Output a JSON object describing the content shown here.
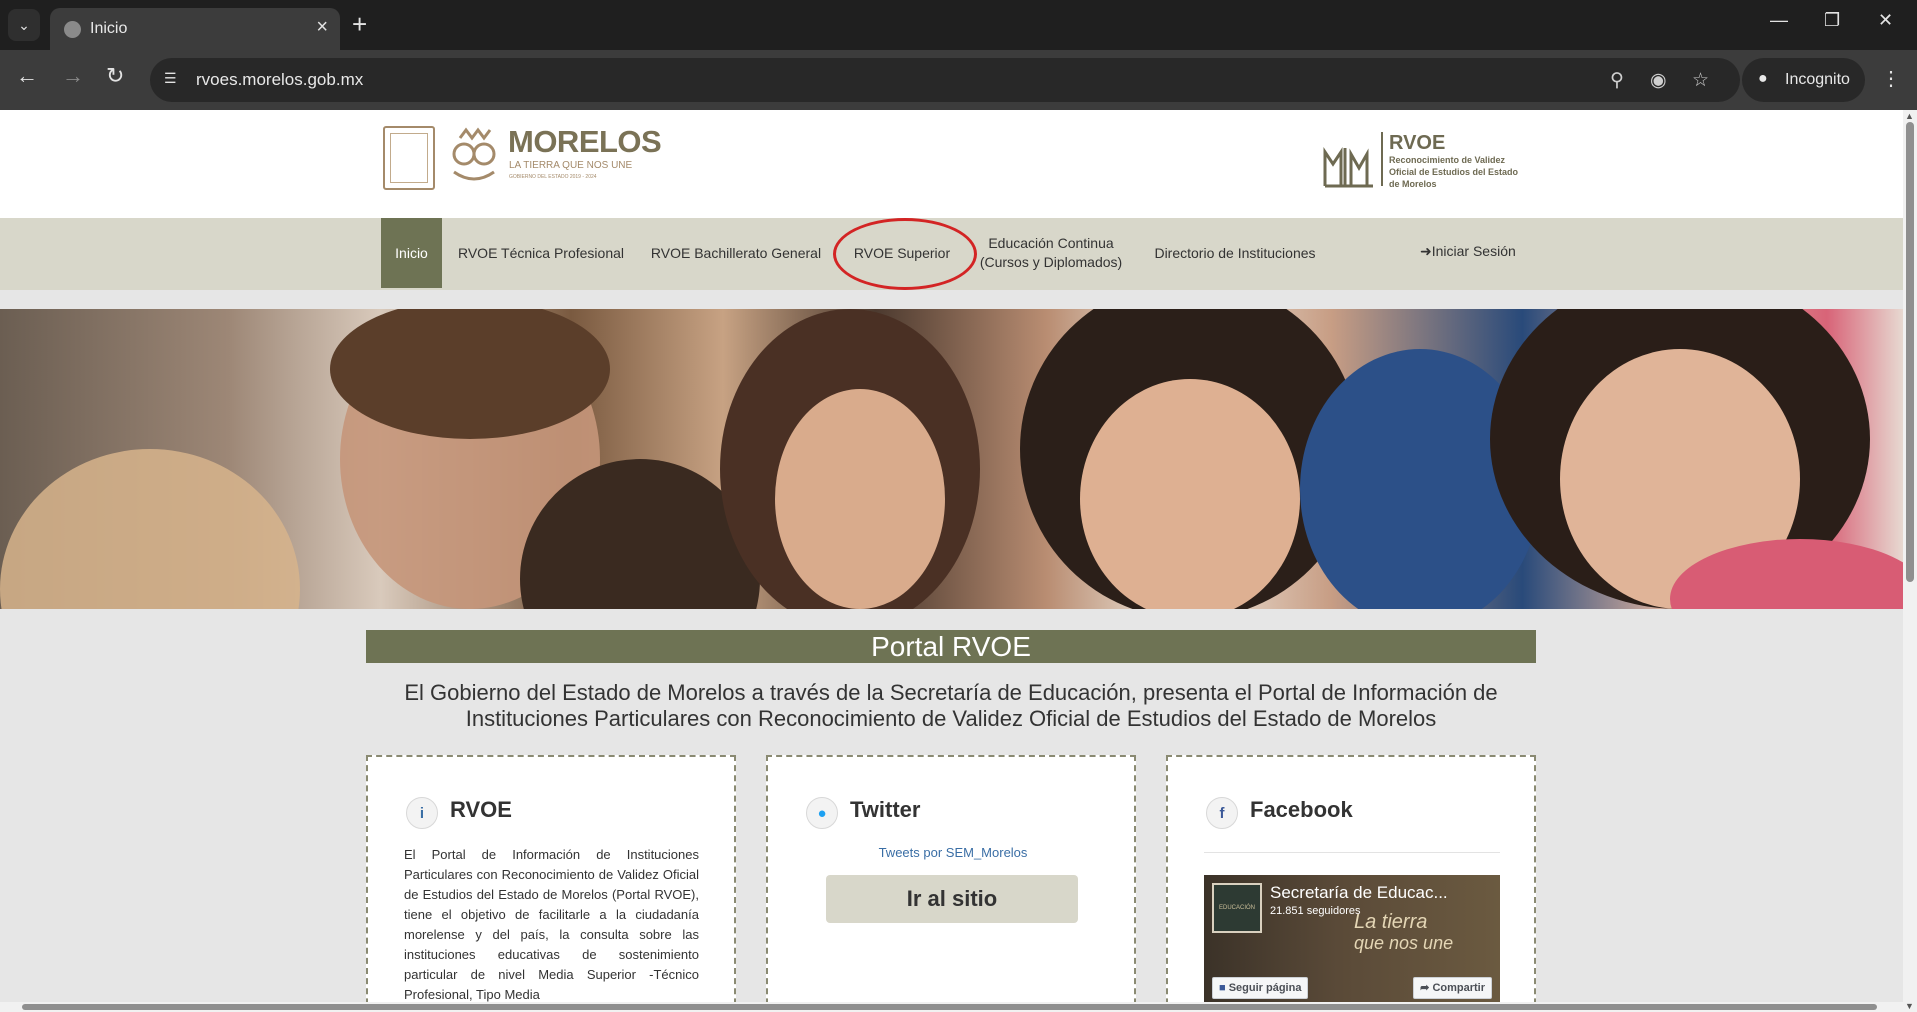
{
  "browser": {
    "tab_title": "Inicio",
    "url": "rvoes.morelos.gob.mx",
    "incognito_label": "Incognito"
  },
  "header": {
    "morelos_name": "MORELOS",
    "morelos_tagline": "LA TIERRA QUE NOS UNE",
    "morelos_small": "GOBIERNO DEL ESTADO 2019 - 2024",
    "rvoe_title": "RVOE",
    "rvoe_subtitle": "Reconocimiento de Validez Oficial de Estudios del Estado de Morelos"
  },
  "nav": {
    "items": [
      {
        "label": "Inicio"
      },
      {
        "label": "RVOE Técnica Profesional"
      },
      {
        "label": "RVOE Bachillerato General"
      },
      {
        "label": "RVOE Superior"
      },
      {
        "label": "Educación Continua\n(Cursos y Diplomados)"
      },
      {
        "label": "Directorio de Instituciones"
      }
    ],
    "login_label": "Iniciar Sesión"
  },
  "content": {
    "portal_title": "Portal RVOE",
    "intro": "El Gobierno del Estado de Morelos a través de la Secretaría de Educación, presenta el Portal de Información de Instituciones Particulares con Reconocimiento de Validez Oficial de Estudios del Estado de Morelos",
    "cards": {
      "rvoe": {
        "title": "RVOE",
        "body": "El Portal de Información de Instituciones Particulares con Reconocimiento de Validez Oficial de Estudios del Estado de Morelos (Portal RVOE), tiene el objetivo de facilitarle a la ciudadanía morelense y del país, la consulta sobre las instituciones educativas de sostenimiento particular de nivel Media Superior -Técnico Profesional, Tipo Media"
      },
      "twitter": {
        "title": "Twitter",
        "link": "Tweets por SEM_Morelos",
        "button": "Ir al sitio"
      },
      "facebook": {
        "title": "Facebook",
        "page_name": "Secretaría de Educac...",
        "followers": "21.851 seguidores",
        "slogan_1": "La tierra",
        "slogan_2": "que nos une",
        "follow_btn": "Seguir página",
        "share_btn": "Compartir"
      }
    }
  },
  "colors": {
    "accent_olive": "#6e7354",
    "nav_bg": "#d8d7ca",
    "highlight": "#d32424"
  }
}
